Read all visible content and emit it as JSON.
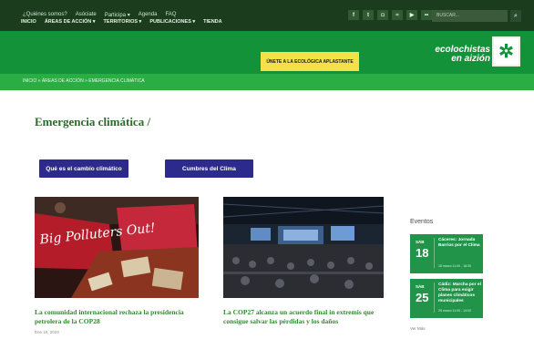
{
  "topbar": {
    "links": [
      "¿Quiénes somos?",
      "Asóciate",
      "Participa ▾",
      "Agenda",
      "FAQ"
    ],
    "social": [
      {
        "icon": "facebook-icon",
        "glyph": "f"
      },
      {
        "icon": "twitter-icon",
        "glyph": "t"
      },
      {
        "icon": "instagram-icon",
        "glyph": "◘"
      },
      {
        "icon": "rss-icon",
        "glyph": "≈"
      },
      {
        "icon": "youtube-icon",
        "glyph": "▶"
      },
      {
        "icon": "flickr-icon",
        "glyph": "••"
      }
    ],
    "search_placeholder": "BUSCAR..."
  },
  "mainnav": {
    "items": [
      "INICIO",
      "ÁREAS DE ACCIÓN ▾",
      "TERRITORIOS ▾",
      "PUBLICACIONES ▾",
      "TIENDA"
    ],
    "cta": "ÚNETE A LA ECOLÓGICA APLASTANTE"
  },
  "logo": {
    "line1": "ecolochistas",
    "line2": "en aizión",
    "mark": "✲"
  },
  "breadcrumb": "INICIO » ÁREAS DE ACCIÓN » EMERGENCIA CLIMÁTICA",
  "page_title": "Emergencia climática /",
  "tags": [
    "Qué es el cambio climático",
    "Cumbres del Clima"
  ],
  "articles": [
    {
      "title": "La comunidad internacional rechaza la presidencia petrolera de la COP28",
      "date": "Ene 16, 2023",
      "banner_text": "Big Polluters Out!"
    },
    {
      "title": "La COP27 alcanza un acuerdo final in extremis que consigue salvar las pérdidas y los daños",
      "date": ""
    }
  ],
  "events": {
    "title": "Eventos",
    "items": [
      {
        "day": "SÁB",
        "num": "18",
        "text": "Cáceres: Jornada Barrios por el Clima",
        "time": "18 marzo 11:00 - 18:30"
      },
      {
        "day": "SÁB",
        "num": "25",
        "text": "Cádiz: Marcha por el Clima para exigir planes climáticos municipales",
        "time": "25 marzo 11:00 - 14:00"
      }
    ],
    "more": "Ver Más"
  },
  "colors": {
    "topbar": "#1b3c1d",
    "nav": "#14923a",
    "breadcrumb": "#2aad42",
    "cta": "#f4e14a",
    "tag": "#2c2b8d",
    "event": "#21944a"
  }
}
